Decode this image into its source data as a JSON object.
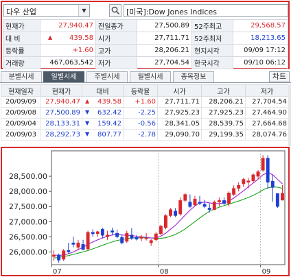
{
  "search": {
    "mode_label": "다우 산업",
    "symbol_name": "[미국]:Dow Jones Indices"
  },
  "quote": {
    "rows": [
      [
        "현재가",
        "27,940.47",
        "전일종가",
        "27,500.89",
        "52주최고",
        "29,568.57"
      ],
      [
        "대 비",
        "439.58",
        "시가",
        "27,711.71",
        "52주최저",
        "18,213.65"
      ],
      [
        "등락률",
        "+1.60",
        "고가",
        "28,206.21",
        "현지시각",
        "09/09 17:12"
      ],
      [
        "거래량",
        "467,063,542",
        "저가",
        "27,704.54",
        "한국시각",
        "09/10 06:12"
      ]
    ],
    "change_direction": "up"
  },
  "tabs": [
    "분별시세",
    "일별시세",
    "주별시세",
    "월별시세",
    "종목정보"
  ],
  "active_tab": 1,
  "chart_button": "차트",
  "daily": {
    "headers": [
      "현재일자",
      "현재가",
      "대비",
      "등락율",
      "시가",
      "고가",
      "저가"
    ],
    "rows": [
      {
        "date": "20/09/09",
        "price": "27,940.47",
        "dir": "up",
        "change": "439.58",
        "rate": "+1.60",
        "open": "27,711.71",
        "high": "28,206.21",
        "low": "27,704.54"
      },
      {
        "date": "20/09/08",
        "price": "27,500.89",
        "dir": "down",
        "change": "632.42",
        "rate": "-2.25",
        "open": "27,925.23",
        "high": "27,925.23",
        "low": "27,464.90"
      },
      {
        "date": "20/09/04",
        "price": "28,133.31",
        "dir": "down",
        "change": "159.42",
        "rate": "-0.56",
        "open": "28,341.05",
        "high": "28,539.75",
        "low": "27,664.68"
      },
      {
        "date": "20/09/03",
        "price": "28,292.73",
        "dir": "down",
        "change": "807.77",
        "rate": "-2.78",
        "open": "29,090.70",
        "high": "29,199.35",
        "low": "28,074.76"
      }
    ]
  },
  "colors": {
    "up": "#d9282d",
    "down": "#1d3fd1",
    "ma_short": "#a020d0",
    "ma_long": "#1aa51a",
    "frame": "#d9282d"
  },
  "chart_data": {
    "type": "candlestick",
    "y_ticks": [
      "28,500.00",
      "28,000.00",
      "27,500.00",
      "27,000.00",
      "26,500.00",
      "26,000.00"
    ],
    "y_tick_values": [
      28500,
      28000,
      27500,
      27000,
      26500,
      26000
    ],
    "ylim": [
      25580,
      29340
    ],
    "x_labels": [
      {
        "label": "07",
        "index": 0
      },
      {
        "label": "08",
        "index": 22
      },
      {
        "label": "09",
        "index": 43
      }
    ],
    "candles": [
      [
        25850,
        26050,
        25700,
        25900
      ],
      [
        25900,
        25950,
        25650,
        25730
      ],
      [
        25760,
        26100,
        25700,
        26040
      ],
      [
        26050,
        26300,
        25950,
        26000
      ],
      [
        26300,
        26500,
        26150,
        26250
      ],
      [
        26150,
        26400,
        26050,
        26300
      ],
      [
        26250,
        26400,
        26050,
        26080
      ],
      [
        26100,
        26700,
        26050,
        26650
      ],
      [
        26650,
        26750,
        26500,
        26600
      ],
      [
        26600,
        26700,
        26500,
        26670
      ],
      [
        26750,
        26800,
        26450,
        26550
      ],
      [
        26500,
        26700,
        26400,
        26560
      ],
      [
        26700,
        26800,
        26550,
        26650
      ],
      [
        26620,
        26740,
        26450,
        26500
      ],
      [
        26480,
        26560,
        26250,
        26300
      ],
      [
        26350,
        26700,
        26300,
        26620
      ],
      [
        26560,
        26780,
        26400,
        26450
      ],
      [
        26480,
        26560,
        26380,
        26420
      ],
      [
        26450,
        26560,
        26350,
        26500
      ],
      [
        26450,
        26620,
        26380,
        26450
      ],
      [
        26300,
        26420,
        26200,
        26380
      ],
      [
        26400,
        26650,
        26350,
        26600
      ],
      [
        26600,
        26900,
        26550,
        26850
      ],
      [
        26800,
        27250,
        26750,
        27200
      ],
      [
        27200,
        27450,
        27150,
        27400
      ],
      [
        27350,
        27450,
        27150,
        27200
      ],
      [
        27250,
        27800,
        27200,
        27700
      ],
      [
        27700,
        27950,
        27650,
        27900
      ],
      [
        27650,
        27900,
        27450,
        27500
      ],
      [
        27550,
        27850,
        27500,
        27750
      ],
      [
        27650,
        27850,
        27550,
        27600
      ],
      [
        27580,
        27720,
        27450,
        27500
      ],
      [
        27450,
        27600,
        27300,
        27400
      ],
      [
        27400,
        27700,
        27380,
        27650
      ],
      [
        27650,
        27800,
        27500,
        27700
      ],
      [
        27700,
        27800,
        27550,
        27600
      ],
      [
        27600,
        28000,
        27500,
        27950
      ],
      [
        27900,
        28200,
        27850,
        28100
      ],
      [
        28100,
        28300,
        28000,
        28200
      ],
      [
        28250,
        28450,
        28150,
        28400
      ],
      [
        28300,
        28450,
        28100,
        28350
      ],
      [
        28350,
        28600,
        28300,
        28550
      ],
      [
        28500,
        28700,
        28400,
        28650
      ],
      [
        28700,
        29200,
        28650,
        29100
      ],
      [
        29100,
        29200,
        28080,
        28300
      ],
      [
        28340,
        28540,
        27660,
        28130
      ],
      [
        27930,
        27930,
        27460,
        27500
      ],
      [
        27710,
        28210,
        27700,
        27940
      ]
    ],
    "ma_short": [
      25900,
      25890,
      25900,
      25940,
      26000,
      26080,
      26150,
      26250,
      26330,
      26400,
      26460,
      26520,
      26560,
      26580,
      26560,
      26550,
      26540,
      26520,
      26500,
      26480,
      26460,
      26460,
      26520,
      26620,
      26750,
      26880,
      27050,
      27220,
      27380,
      27520,
      27620,
      27650,
      27620,
      27600,
      27600,
      27620,
      27680,
      27780,
      27900,
      28020,
      28150,
      28280,
      28400,
      28550,
      28620,
      28550,
      28400,
      28250
    ],
    "ma_long": [
      25800,
      25820,
      25850,
      25880,
      25920,
      25960,
      26000,
      26050,
      26100,
      26160,
      26220,
      26280,
      26330,
      26380,
      26410,
      26440,
      26460,
      26470,
      26470,
      26470,
      26460,
      26450,
      26450,
      26470,
      26520,
      26580,
      26660,
      26760,
      26880,
      27000,
      27120,
      27240,
      27340,
      27420,
      27480,
      27530,
      27580,
      27630,
      27680,
      27740,
      27800,
      27870,
      27950,
      28050,
      28120,
      28150,
      28140,
      28100
    ]
  }
}
